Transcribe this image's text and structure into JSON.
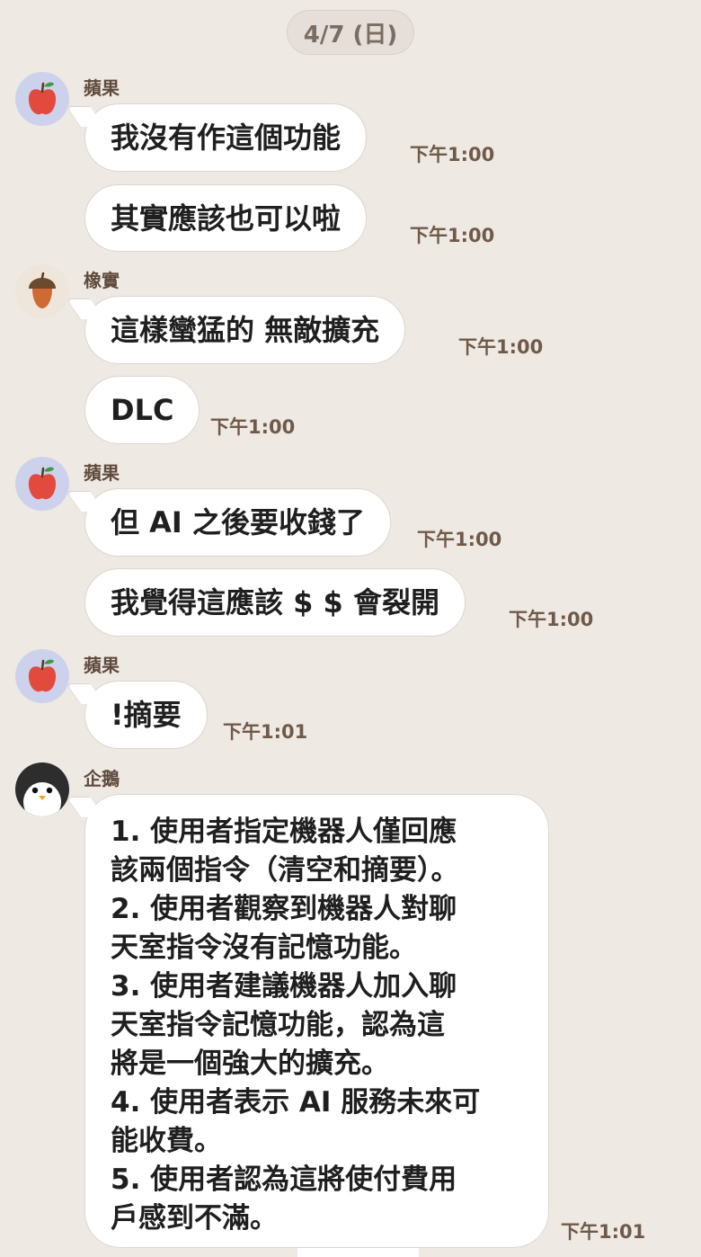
{
  "date": "4/7 (日)",
  "messages": [
    {
      "sender": "蘋果",
      "text": "我沒有作這個功能",
      "time": "下午1:00"
    },
    {
      "text": "其實應該也可以啦",
      "time": "下午1:00"
    },
    {
      "sender": "橡實",
      "text": "這樣蠻猛的  無敵擴充",
      "time": "下午1:00"
    },
    {
      "text": "DLC",
      "time": "下午1:00"
    },
    {
      "sender": "蘋果",
      "text": "但 AI 之後要收錢了",
      "time": "下午1:00"
    },
    {
      "text": "我覺得這應該 $  $ 會裂開",
      "time": "下午1:00"
    },
    {
      "sender": "蘋果",
      "text": "!摘要",
      "time": "下午1:01"
    },
    {
      "sender": "企鵝",
      "text": "1. 使用者指定機器人僅回應\n該兩個指令（清空和摘要）。\n2. 使用者觀察到機器人對聊\n天室指令沒有記憶功能。\n3. 使用者建議機器人加入聊\n天室指令記憶功能，認為這\n將是一個強大的擴充。\n4. 使用者表示 AI 服務未來可\n能收費。\n5. 使用者認為這將使付費用\n戶感到不滿。",
      "time": "下午1:01"
    }
  ],
  "avatars": {
    "apple": "apple-icon",
    "acorn": "acorn-icon",
    "penguin": "penguin-icon"
  },
  "colors": {
    "background": "#efe9e3",
    "bubble": "#ffffff",
    "name": "#5e4b3d",
    "time": "#6f5a4a"
  }
}
